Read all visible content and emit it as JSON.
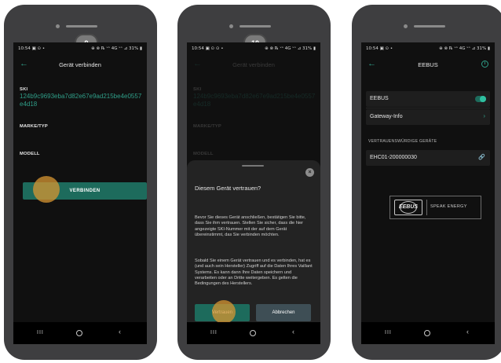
{
  "status": {
    "time": "10:54",
    "left_icons_1": "10:54 ▣ ⊙ •",
    "left_icons_2": "10:54 ▣ ⊙ ⊙ •",
    "right_icons": "⊕ ⊗ ℞ ᵛᵒ 4G ᵛᵒ ⊿ 31% ▮"
  },
  "screen1": {
    "step": "9",
    "title": "Gerät verbinden",
    "ski_label": "SKI",
    "ski_value": "124b9c9693eba7d82e67e9ad215be4e0557e4d18",
    "brand_label": "MARKE/TYP",
    "model_label": "MODELL",
    "connect_button": "VERBINDEN"
  },
  "screen2": {
    "step": "10",
    "title": "Gerät verbinden",
    "ski_label": "SKI",
    "ski_value": "124b9c9693eba7d82e67e9ad215be4e0557e4d18",
    "brand_label": "MARKE/TYP",
    "model_label": "MODELL",
    "dialog": {
      "title": "Diesem Gerät vertrauen?",
      "paragraph1": "Bevor Sie dieses Gerät anschließen, bestätigen Sie bitte, dass Sie ihm vertrauen. Stellen Sie sicher, dass die hier angezeigte SKI-Nummer mit der auf dem Gerät übereinstimmt, das Sie verbinden möchten.",
      "paragraph2": "Sobald Sie einem Gerät vertrauen und es verbinden, hat es (und auch sein Hersteller) Zugriff auf die Daten Ihres Vaillant Systems. Es kann dann Ihre Daten speichern und verarbeiten oder an Dritte weitergeben. Es gelten die Bedingungen des Herstellers.",
      "trust_button": "Vertrauen",
      "cancel_button": "Abbrechen",
      "close_icon": "×"
    }
  },
  "screen3": {
    "title": "EEBUS",
    "info_icon": "i",
    "eebus_row": "EEBUS",
    "eebus_toggle": "on",
    "gateway_row": "Gateway-Info",
    "trusted_label": "VERTRAUENSWÜRDIGE GERÄTE",
    "device_row": "EHC01-200000030",
    "logo_text": "EEBUS",
    "logo_slogan": "SPEAK ENERGY"
  },
  "nav": {
    "recents": "III",
    "back": "‹"
  },
  "icons": {
    "back": "arrow-left-icon",
    "chevron": "chevron-right-icon",
    "link": "link-icon",
    "close": "close-icon",
    "info": "info-icon"
  },
  "colors": {
    "accent": "#2f9e88",
    "button": "#1d6b5c",
    "cancel_button": "#3e4e55",
    "touch_indicator": "#d79632",
    "screen_bg": "#101010",
    "phone_body": "#3e3e40"
  }
}
